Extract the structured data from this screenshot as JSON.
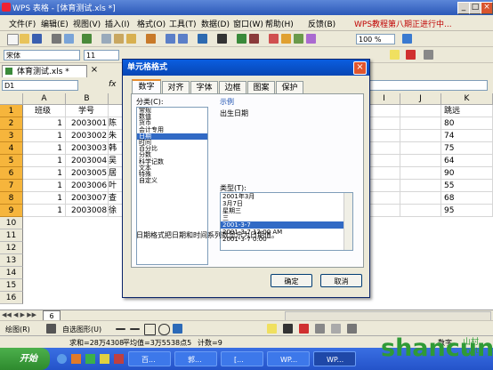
{
  "window": {
    "title": "WPS 表格 - [体育测试.xls *]"
  },
  "menu": {
    "items": [
      "文件(F)",
      "编辑(E)",
      "视图(V)",
      "插入(I)",
      "格式(O)",
      "工具(T)",
      "数据(D)",
      "窗口(W)",
      "帮助(H)",
      "反馈(B)"
    ],
    "news": "WPS教程第八期正进行中..."
  },
  "toolbar": {
    "zoom": "100 %",
    "font_name": "宋体",
    "font_size": "11"
  },
  "doc_tab": {
    "label": "体育测试.xls *"
  },
  "name_box": {
    "value": "D1"
  },
  "sheet": {
    "columns": [
      "A",
      "B",
      "",
      "",
      "",
      "",
      "",
      "",
      "I",
      "J",
      "K"
    ],
    "right_header": "跳远",
    "rows": [
      {
        "num": "1",
        "a": "班级",
        "b": "学号",
        "c": "",
        "k": ""
      },
      {
        "num": "2",
        "a": "1",
        "b": "2003001",
        "c": "陈",
        "k": "80"
      },
      {
        "num": "3",
        "a": "1",
        "b": "2003002",
        "c": "朱",
        "k": "74"
      },
      {
        "num": "4",
        "a": "1",
        "b": "2003003",
        "c": "韩",
        "k": "75"
      },
      {
        "num": "5",
        "a": "1",
        "b": "2003004",
        "c": "吴",
        "k": "64"
      },
      {
        "num": "6",
        "a": "1",
        "b": "2003005",
        "c": "居",
        "k": "90"
      },
      {
        "num": "7",
        "a": "1",
        "b": "2003006",
        "c": "叶",
        "k": "55"
      },
      {
        "num": "8",
        "a": "1",
        "b": "2003007",
        "c": "查",
        "k": "68"
      },
      {
        "num": "9",
        "a": "1",
        "b": "2003008",
        "c": "徐",
        "k": "95"
      }
    ],
    "plain_rows": [
      "10",
      "11",
      "12",
      "13",
      "14",
      "15",
      "16"
    ],
    "sheet_tab": "6"
  },
  "dialog": {
    "title": "单元格格式",
    "close": "×",
    "tabs": [
      "数字",
      "对齐",
      "字体",
      "边框",
      "图案",
      "保护"
    ],
    "category_label": "分类(C):",
    "categories": [
      "常规",
      "数值",
      "货币",
      "会计专用",
      "日期",
      "时间",
      "百分比",
      "分数",
      "科学记数",
      "文本",
      "特殊",
      "自定义"
    ],
    "selected_category": "日期",
    "sample_label": "示例",
    "sample_value": "出生日期",
    "type_label": "类型(T):",
    "types": [
      "2001年3月",
      "3月7日",
      "星期三",
      "三",
      "2001-3-7",
      "2001-3-7 12:00 AM",
      "2001-3-7 0:00"
    ],
    "selected_type": "2001-3-7",
    "description": "日期格式把日期和时间系列数显示为日期值。",
    "ok": "确定",
    "cancel": "取消"
  },
  "drawing": {
    "label": "绘图(R)",
    "autoshape": "自选图形(U)"
  },
  "status": {
    "sum": "求和=28万4308",
    "avg": "平均值=3万5538点5",
    "count": "计数=9",
    "mode": "数字"
  },
  "taskbar": {
    "start": "开始",
    "items": [
      "百...",
      "郭...",
      "[...",
      "WP...",
      "WP..."
    ]
  },
  "watermark": {
    "text": "shancun",
    "sub": "山村\n.net"
  },
  "colors": {
    "accent": "#316ac5",
    "row_highlight": "#f6b53c",
    "watermark": "#2f9a36"
  }
}
